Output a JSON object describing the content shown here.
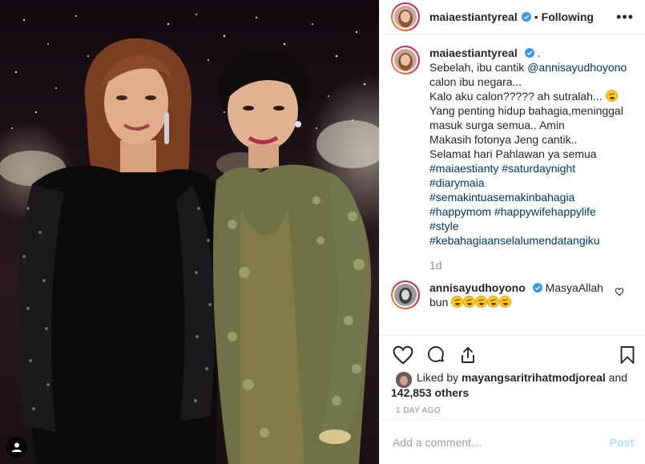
{
  "post": {
    "author": "maiaestiantyreal",
    "separator": "•",
    "follow_status": "Following",
    "more_label": "•••"
  },
  "caption": {
    "author": "maiaestiantyreal",
    "after_badge": ".",
    "line1_prefix": "Sebelah, ibu cantik ",
    "line1_mention": "@annisayudhoyono",
    "line2": "calon ibu negara...",
    "line3": "Kalo aku calon????? ah sutralah...",
    "line4": "Yang penting hidup bahagia,meninggal",
    "line5": "masuk surga semua.. Amin",
    "line6": "Makasih fotonya Jeng cantik..",
    "line7": "Selamat hari Pahlawan ya semua",
    "hashtags_line1": "#maiaestianty #saturdaynight",
    "hashtags_line2": "#diarymaia",
    "hashtags_line3": "#semakintuasemakinbahagia",
    "hashtags_line4": "#happymom #happywifehappylife",
    "hashtags_line5": "#style",
    "hashtags_line6": "#kebahagiaanselalumendatangiku",
    "time": "1d"
  },
  "comment": {
    "author": "annisayudhoyono",
    "text_line1": "MasyaAllah",
    "text_line2": "bun"
  },
  "likes": {
    "prefix": "Liked by ",
    "user": "mayangsaritrihatmodjoreal",
    "middle": " and",
    "count": "142,853 others"
  },
  "time_ago": "1 DAY AGO",
  "add_comment": {
    "placeholder": "Add a comment…",
    "post_label": "Post"
  },
  "colors": {
    "link": "#003569",
    "verified": "#3897f0",
    "post_disabled": "#b2dffc"
  },
  "icons": [
    "verified-icon",
    "more-icon",
    "heart-icon",
    "comment-icon",
    "share-icon",
    "bookmark-icon",
    "user-tag-icon",
    "laughing-emoji"
  ]
}
